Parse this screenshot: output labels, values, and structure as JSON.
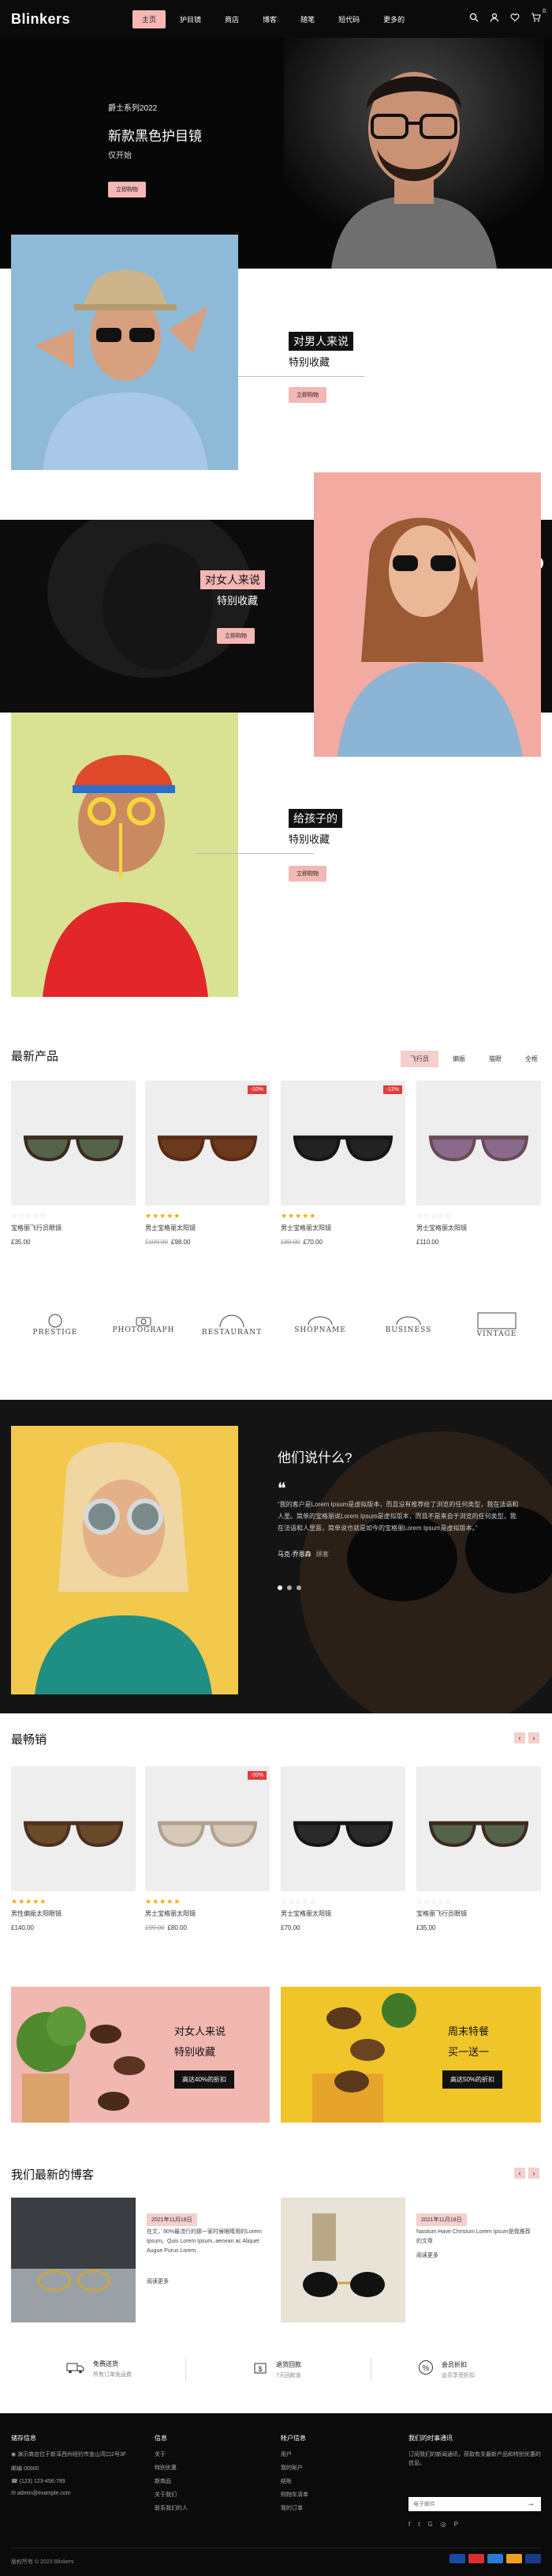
{
  "header": {
    "logo": "Blinkers",
    "nav": [
      {
        "label": "主页",
        "active": true
      },
      {
        "label": "护目镜",
        "active": false
      },
      {
        "label": "商店",
        "active": false
      },
      {
        "label": "博客",
        "active": false
      },
      {
        "label": "随笔",
        "active": false
      },
      {
        "label": "短代码",
        "active": false
      },
      {
        "label": "更多的",
        "active": false
      }
    ],
    "icons": [
      "search-icon",
      "user-icon",
      "heart-icon",
      "cart-icon"
    ],
    "cart_count": "0"
  },
  "hero": {
    "subtitle": "爵士系列2022",
    "title": "新款黑色护目镜",
    "note": "仅开始",
    "button": "立即购物"
  },
  "categories": [
    {
      "tag": "对男人来说",
      "sub": "特别收藏",
      "button": "立即购物"
    },
    {
      "tag": "对女人来说",
      "sub": "特别收藏",
      "button": "立即购物"
    },
    {
      "tag": "给孩子的",
      "sub": "特别收藏",
      "button": "立即购物"
    }
  ],
  "latest": {
    "title": "最新产品",
    "tabs": [
      {
        "label": "飞行员",
        "active": true
      },
      {
        "label": "偏振",
        "active": false
      },
      {
        "label": "猫眼",
        "active": false
      },
      {
        "label": "全框",
        "active": false
      }
    ],
    "products": [
      {
        "name": "宝格丽飞行员眼镜",
        "price": "£35.00",
        "old": "",
        "stars": "☆☆☆☆☆",
        "rated": false,
        "badge": "",
        "frame": "#3b2a20",
        "lens": "#55634a"
      },
      {
        "name": "男士宝格丽太阳镜",
        "price": "£98.00",
        "old": "£109.00",
        "stars": "★★★★★",
        "rated": true,
        "badge": "-10%",
        "frame": "#5a2a12",
        "lens": "#6b3a1c"
      },
      {
        "name": "男士宝格丽太阳镜",
        "price": "£70.00",
        "old": "£80.00",
        "stars": "★★★★★",
        "rated": true,
        "badge": "-13%",
        "frame": "#151515",
        "lens": "#222"
      },
      {
        "name": "男士宝格丽太阳镜",
        "price": "£110.00",
        "old": "",
        "stars": "☆☆☆☆☆",
        "rated": false,
        "badge": "",
        "frame": "#6a4a5a",
        "lens": "#8a6a8a"
      }
    ]
  },
  "brands": [
    "PRESTIGE",
    "PHOTOGRAPH",
    "RESTAURANT",
    "SHOPNAME",
    "BUSINESS",
    "VINTAGE"
  ],
  "testimonial": {
    "title": "他们说什么?",
    "quote": "❝",
    "text": "“我的客户是Lorem Ipsum是虚拟版本，而且没有推荐给了浏览的任何类型，我在法语和人里。简单的宝格丽说Lorem Ipsum是虚拟版本，而且不是来自于浏览的任何类型，我在法语和人里面，简单说也就是如今的宝格丽Lorem Ipsum是虚拟版本。”",
    "name": "马克·乔恩森",
    "role": "顾客"
  },
  "bestsellers": {
    "title": "最畅销",
    "products": [
      {
        "name": "男性偏振太阳眼镜",
        "price": "£140.00",
        "old": "",
        "stars": "★★★★★",
        "rated": true,
        "badge": "",
        "frame": "#4a3020",
        "lens": "#6b4a2a"
      },
      {
        "name": "男士宝格丽太阳镜",
        "price": "£80.00",
        "old": "£99.00",
        "stars": "★★★★★",
        "rated": true,
        "badge": "-20%",
        "frame": "#b0a090",
        "lens": "#d8c8b8"
      },
      {
        "name": "男士宝格丽太阳镜",
        "price": "£70.00",
        "old": "",
        "stars": "☆☆☆☆☆",
        "rated": false,
        "badge": "",
        "frame": "#151515",
        "lens": "#2a2a2a"
      },
      {
        "name": "宝格丽飞行员眼镜",
        "price": "£35.00",
        "old": "",
        "stars": "☆☆☆☆☆",
        "rated": false,
        "badge": "",
        "frame": "#3b2a20",
        "lens": "#55634a"
      }
    ]
  },
  "promos": [
    {
      "title": "对女人来说",
      "sub": "特别收藏",
      "button": "高达40%的折扣"
    },
    {
      "title": "周末特餐",
      "sub": "买一送一",
      "button": "高达50%的折扣"
    }
  ],
  "blog": {
    "title": "我们最新的博客",
    "posts": [
      {
        "date": "2021年11月18日",
        "text": "在文，90%最流行的那一家时候眼睛用的Lorem Ipsum。Quis Lorem Ipsum, aenean ac Aliquet Augue Purus Lorem.",
        "more": "阅读更多"
      },
      {
        "date": "2021年11月18日",
        "text": "Nastium Have Christum Lorem Ipsum是我推荐的文章",
        "more": "阅读更多"
      }
    ]
  },
  "features": [
    {
      "icon": "truck-icon",
      "title": "免费送货",
      "sub": "所有订单免运费"
    },
    {
      "icon": "money-icon",
      "title": "退货回款",
      "sub": "7天回款金"
    },
    {
      "icon": "percent-icon",
      "title": "会员折扣",
      "sub": "会员享受折扣"
    }
  ],
  "footer": {
    "store": {
      "title": "储存信息",
      "lines": [
        "演示商店位于新泽西州纽约市金山湾口2号3F",
        "邮编 00000",
        "(123) 123-456-789",
        "admin@example.com"
      ]
    },
    "info": {
      "title": "信息",
      "links": [
        "关于",
        "特别优惠",
        "新商品",
        "关于我们",
        "联系我们的人"
      ]
    },
    "account": {
      "title": "帐户信息",
      "links": [
        "用户",
        "我的账户",
        "结账",
        "购物车清单",
        "我的订单"
      ]
    },
    "newsletter": {
      "title": "我们的时事通讯",
      "text": "订阅我们的新闻通讯，获取有关最新产品和特别优惠的信息。",
      "placeholder": "电子邮件",
      "button": "→"
    },
    "copyright": "版权所有 © 2023 Blinkers",
    "social": [
      "facebook-icon",
      "twitter-icon",
      "google-icon",
      "instagram-icon",
      "pinterest-icon"
    ]
  },
  "colors": {
    "accent": "#f4b7b4",
    "dark": "#0b0b0b",
    "sale": "#e23b3b"
  }
}
